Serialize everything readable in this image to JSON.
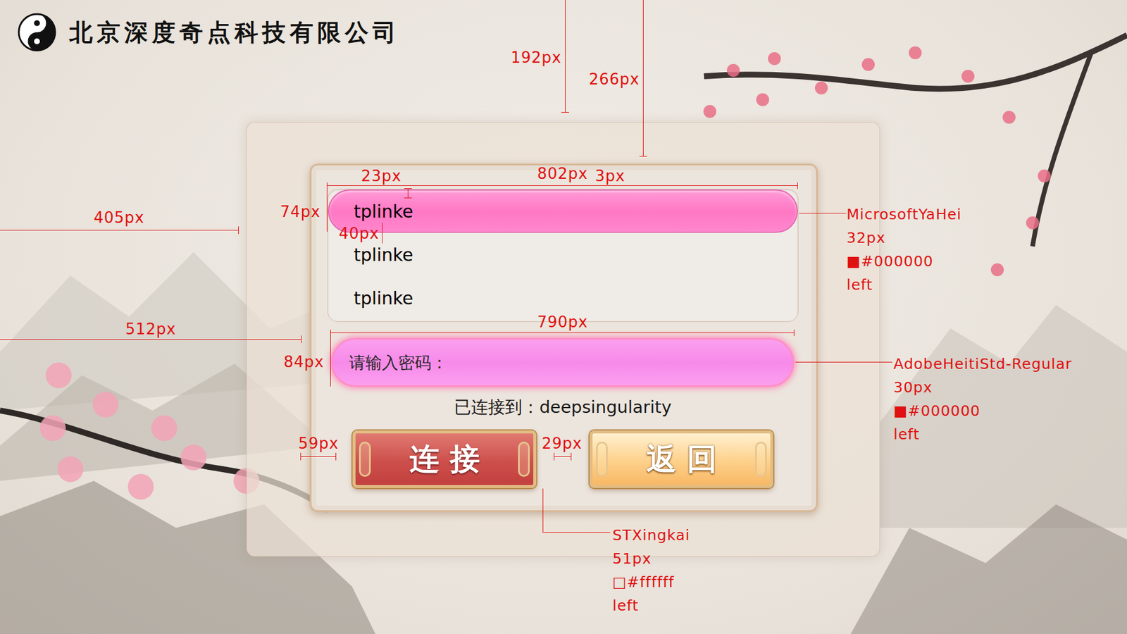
{
  "company": {
    "name": "北京深度奇点科技有限公司"
  },
  "wifi_list": {
    "items": [
      {
        "label": "tplinke",
        "selected": true
      },
      {
        "label": "tplinke",
        "selected": false
      },
      {
        "label": "tplinke",
        "selected": false
      }
    ]
  },
  "password": {
    "placeholder": "请输入密码："
  },
  "status": "已连接到：deepsingularity",
  "buttons": [
    {
      "label": "连接",
      "kind": "primary"
    },
    {
      "label": "返回",
      "kind": "secondary"
    }
  ],
  "annotations": [
    {
      "kind": "dimension",
      "lines": [
        "192px"
      ]
    },
    {
      "kind": "dimension",
      "lines": [
        "266px"
      ]
    },
    {
      "kind": "dimension",
      "lines": [
        "405px"
      ]
    },
    {
      "kind": "dimension",
      "lines": [
        "512px"
      ]
    },
    {
      "kind": "dimension",
      "lines": [
        "802px"
      ]
    },
    {
      "kind": "dimension",
      "lines": [
        "23px"
      ]
    },
    {
      "kind": "dimension",
      "lines": [
        "3px"
      ]
    },
    {
      "kind": "dimension",
      "lines": [
        "74px"
      ]
    },
    {
      "kind": "dimension",
      "lines": [
        "40px"
      ]
    },
    {
      "kind": "dimension",
      "lines": [
        "790px"
      ]
    },
    {
      "kind": "dimension",
      "lines": [
        "84px"
      ]
    },
    {
      "kind": "dimension",
      "lines": [
        "59px"
      ]
    },
    {
      "kind": "dimension",
      "lines": [
        "29px"
      ]
    },
    {
      "kind": "spec",
      "lines": [
        "MicrosoftYaHei",
        "32px",
        "■#000000",
        "left"
      ]
    },
    {
      "kind": "spec",
      "lines": [
        "AdobeHeitiStd-Regular",
        "30px",
        "■#000000",
        "left"
      ]
    },
    {
      "kind": "spec",
      "lines": [
        "STXingkai",
        "51px",
        "□#ffffff",
        "left"
      ]
    }
  ]
}
